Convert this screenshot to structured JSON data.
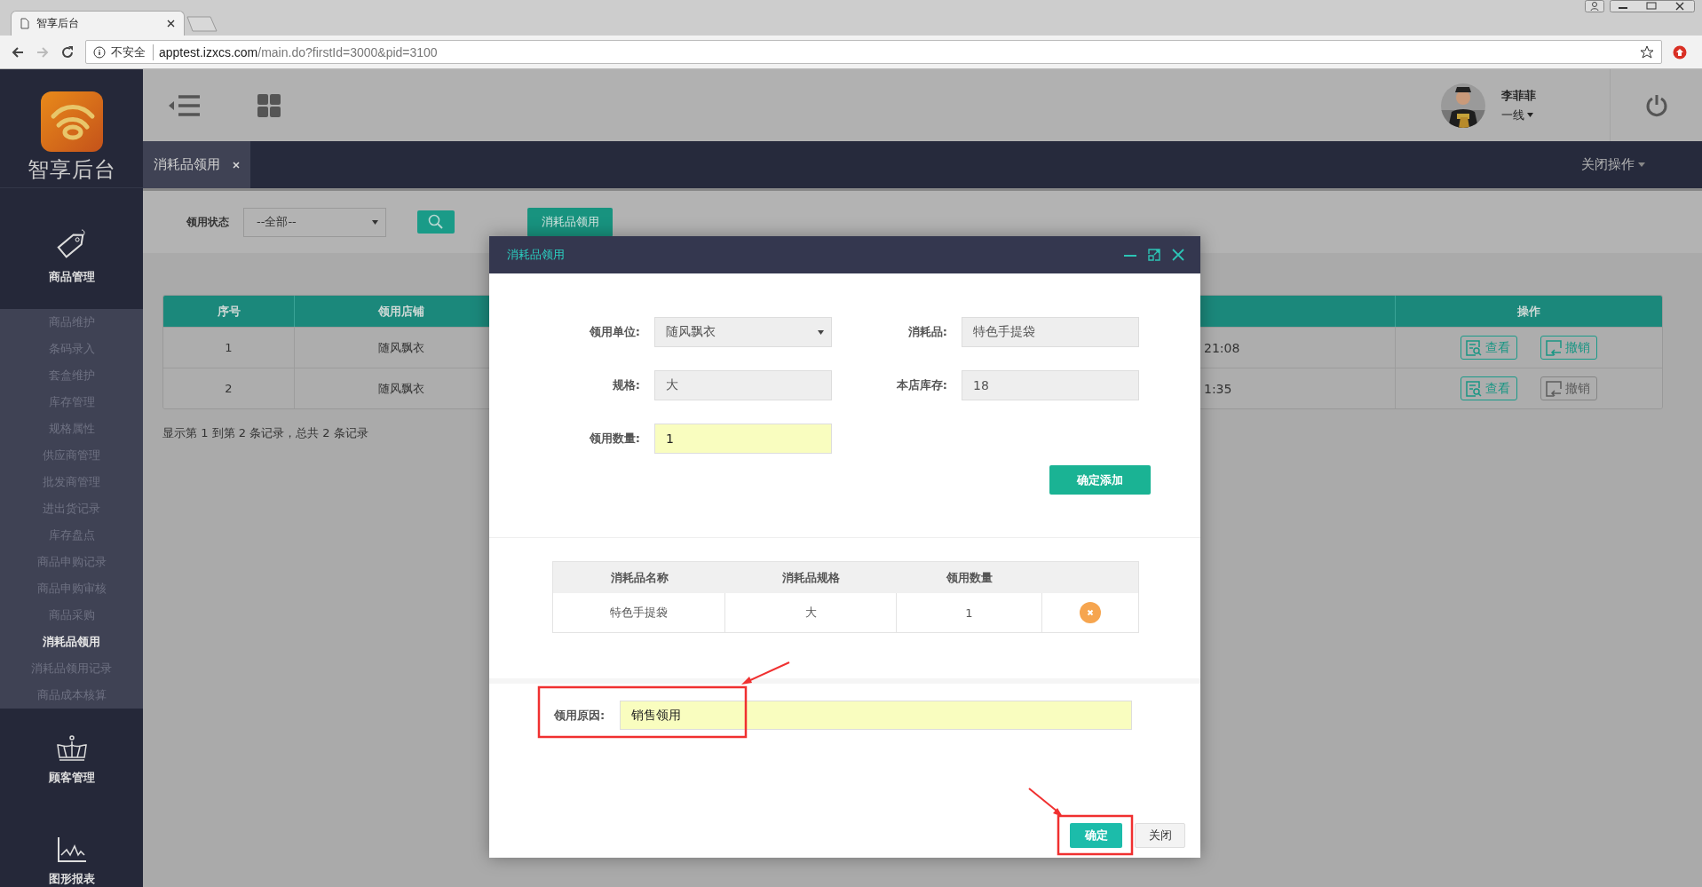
{
  "browser": {
    "tab_title": "智享后台",
    "security_label": "不安全",
    "url_host": "apptest.izxcs.com",
    "url_path": "/main.do?firstId=3000&pid=3100"
  },
  "sidebar": {
    "logo_text": "智享后台",
    "sections": [
      {
        "label": "商品管理",
        "items": [
          {
            "label": "商品维护",
            "selected": false
          },
          {
            "label": "条码录入",
            "selected": false
          },
          {
            "label": "套盒维护",
            "selected": false
          },
          {
            "label": "库存管理",
            "selected": false
          },
          {
            "label": "规格属性",
            "selected": false
          },
          {
            "label": "供应商管理",
            "selected": false
          },
          {
            "label": "批发商管理",
            "selected": false
          },
          {
            "label": "进出货记录",
            "selected": false
          },
          {
            "label": "库存盘点",
            "selected": false
          },
          {
            "label": "商品申购记录",
            "selected": false
          },
          {
            "label": "商品申购审核",
            "selected": false
          },
          {
            "label": "商品采购",
            "selected": false
          },
          {
            "label": "消耗品领用",
            "selected": true
          },
          {
            "label": "消耗品领用记录",
            "selected": false
          },
          {
            "label": "商品成本核算",
            "selected": false
          }
        ]
      },
      {
        "label": "顾客管理"
      },
      {
        "label": "图形报表"
      }
    ]
  },
  "header": {
    "user": {
      "name": "李菲菲",
      "role": "一线"
    }
  },
  "tab_bar": {
    "tabs": [
      {
        "label": "消耗品领用",
        "selected": true
      }
    ],
    "close_all": "关闭操作"
  },
  "filter": {
    "label": "领用状态",
    "select_value": "--全部--",
    "action_button": "消耗品领用"
  },
  "table": {
    "columns": {
      "index": "序号",
      "store": "领用店铺",
      "actions": "操作"
    },
    "rows": [
      {
        "index": "1",
        "store": "随风飘衣",
        "time": "21:08",
        "view": "查看",
        "revoke": "撤销",
        "revoke_disabled": false
      },
      {
        "index": "2",
        "store": "随风飘衣",
        "time": "1:35",
        "view": "查看",
        "revoke": "撤销",
        "revoke_disabled": true
      }
    ]
  },
  "footer_text": "显示第 1 到第 2 条记录，总共 2 条记录",
  "dialog": {
    "title": "消耗品领用",
    "fields": [
      {
        "label": "领用单位:",
        "value": "随风飘衣",
        "kind": "select"
      },
      {
        "label": "消耗品:",
        "value": "特色手提袋",
        "kind": "readonly"
      },
      {
        "label": "规格:",
        "value": "大",
        "kind": "readonly"
      },
      {
        "label": "本店库存:",
        "value": "18",
        "kind": "readonly"
      },
      {
        "label": "领用数量:",
        "value": "1",
        "kind": "input"
      }
    ],
    "add_button": "确定添加",
    "items_table": {
      "columns": [
        "消耗品名称",
        "消耗品规格",
        "领用数量"
      ],
      "rows": [
        {
          "name": "特色手提袋",
          "spec": "大",
          "quantity": "1"
        }
      ]
    },
    "reason": {
      "label": "领用原因:",
      "value": "销售领用"
    },
    "buttons": [
      {
        "label": "确定",
        "kind": "primary"
      },
      {
        "label": "关闭",
        "kind": "default"
      }
    ]
  }
}
